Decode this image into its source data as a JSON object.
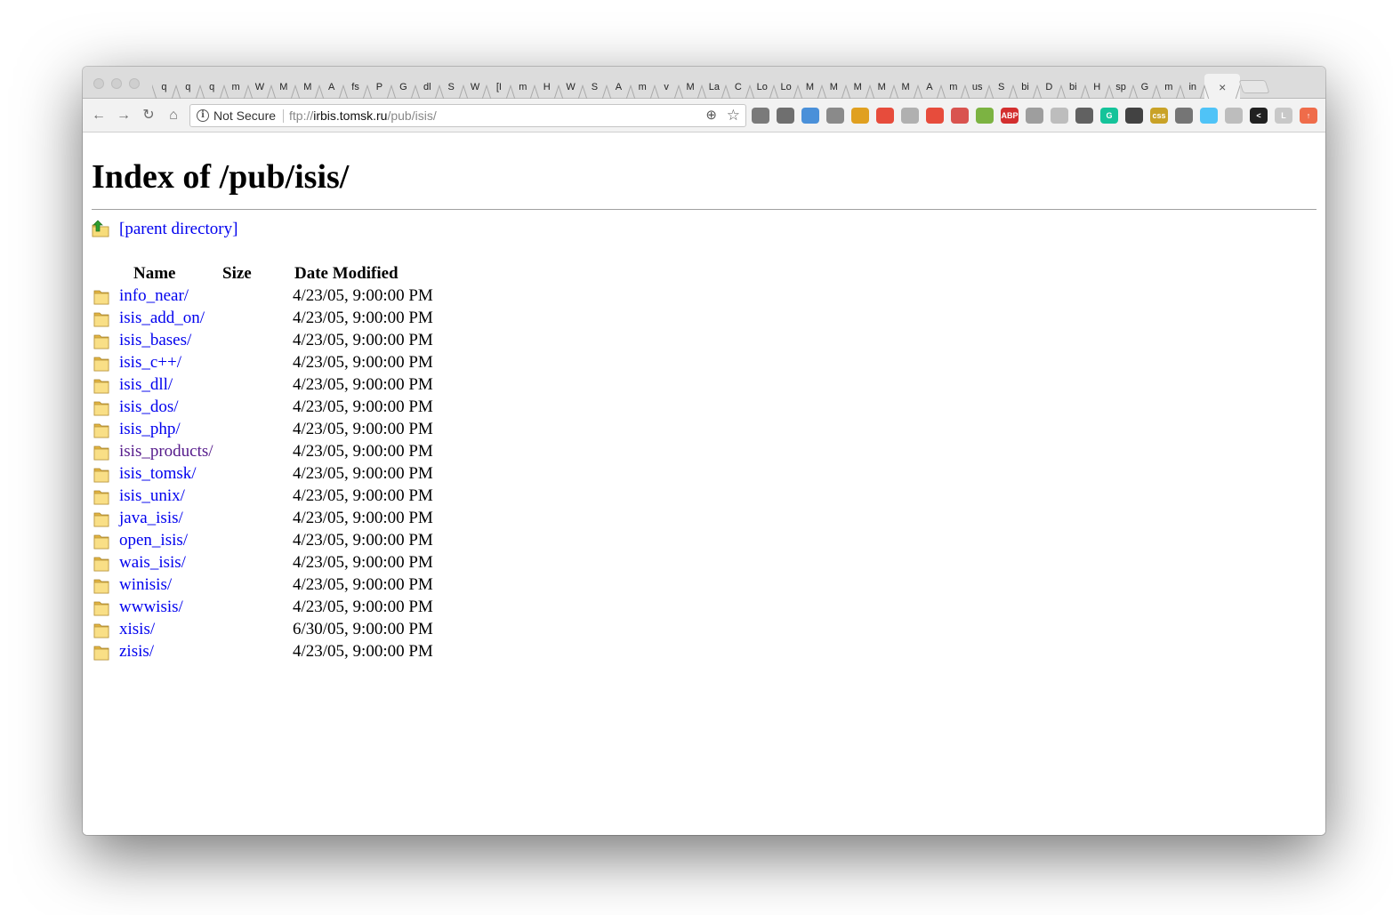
{
  "tabs": [
    "q",
    "q",
    "q",
    "m",
    "W",
    "M",
    "M",
    "A",
    "fs",
    "P",
    "G",
    "dl",
    "S",
    "W",
    "[I",
    "m",
    "H",
    "W",
    "S",
    "A",
    "m",
    "v",
    "M",
    "La",
    "C",
    "Lo",
    "Lo",
    "M",
    "M",
    "M",
    "M",
    "M",
    "A",
    "m",
    "us",
    "S",
    "bi",
    "D",
    "bi",
    "H",
    "sp",
    "G",
    "m",
    "in"
  ],
  "active_tab_close": "×",
  "toolbar": {
    "back_icon": "←",
    "forward_icon": "→",
    "reload_icon": "↻",
    "home_icon": "⌂",
    "security_label": "Not Secure",
    "url_scheme": "ftp://",
    "url_host": "irbis.tomsk.ru",
    "url_path": "/pub/isis/",
    "zoom_icon": "⊕",
    "star_icon": "☆"
  },
  "extensions": [
    {
      "name": "evernote-icon",
      "color": "#7a7a7a",
      "glyph": ""
    },
    {
      "name": "pocket-icon",
      "color": "#6f6f6f",
      "glyph": ""
    },
    {
      "name": "extension-blue-icon",
      "color": "#4a90d9",
      "glyph": ""
    },
    {
      "name": "extension-gray-icon",
      "color": "#8a8a8a",
      "glyph": ""
    },
    {
      "name": "extension-color-icon",
      "color": "#e0a020",
      "glyph": ""
    },
    {
      "name": "extension-red-icon",
      "color": "#e74c3c",
      "glyph": ""
    },
    {
      "name": "extension-circle-icon",
      "color": "#b0b0b0",
      "glyph": ""
    },
    {
      "name": "extension-shield-icon",
      "color": "#e74c3c",
      "glyph": ""
    },
    {
      "name": "extension-ad-icon",
      "color": "#d9534f",
      "glyph": ""
    },
    {
      "name": "extension-green-icon",
      "color": "#7cb342",
      "glyph": ""
    },
    {
      "name": "adblock-plus-icon",
      "color": "#d32f2f",
      "glyph": "ABP"
    },
    {
      "name": "extension-globe-icon",
      "color": "#9e9e9e",
      "glyph": ""
    },
    {
      "name": "extension-check-icon",
      "color": "#bdbdbd",
      "glyph": ""
    },
    {
      "name": "extension-ghost-icon",
      "color": "#616161",
      "glyph": ""
    },
    {
      "name": "grammarly-icon",
      "color": "#15c39a",
      "glyph": "G"
    },
    {
      "name": "extension-bird-icon",
      "color": "#424242",
      "glyph": ""
    },
    {
      "name": "css-icon",
      "color": "#c9a227",
      "glyph": "css"
    },
    {
      "name": "extension-frame-icon",
      "color": "#757575",
      "glyph": ""
    },
    {
      "name": "extension-spiral-icon",
      "color": "#4fc3f7",
      "glyph": ""
    },
    {
      "name": "extension-sync-icon",
      "color": "#bdbdbd",
      "glyph": ""
    },
    {
      "name": "extension-chevron-icon",
      "color": "#212121",
      "glyph": "<"
    },
    {
      "name": "extension-l-icon",
      "color": "#c8c8c8",
      "glyph": "L"
    },
    {
      "name": "extension-upload-icon",
      "color": "#ef6c4a",
      "glyph": "↑"
    }
  ],
  "page": {
    "title": "Index of /pub/isis/",
    "parent_link": "[parent directory]",
    "columns": {
      "name": "Name",
      "size": "Size",
      "date": "Date Modified"
    },
    "entries": [
      {
        "name": "info_near/",
        "size": "",
        "date": "4/23/05, 9:00:00 PM",
        "visited": false
      },
      {
        "name": "isis_add_on/",
        "size": "",
        "date": "4/23/05, 9:00:00 PM",
        "visited": false
      },
      {
        "name": "isis_bases/",
        "size": "",
        "date": "4/23/05, 9:00:00 PM",
        "visited": false
      },
      {
        "name": "isis_c++/",
        "size": "",
        "date": "4/23/05, 9:00:00 PM",
        "visited": false
      },
      {
        "name": "isis_dll/",
        "size": "",
        "date": "4/23/05, 9:00:00 PM",
        "visited": false
      },
      {
        "name": "isis_dos/",
        "size": "",
        "date": "4/23/05, 9:00:00 PM",
        "visited": false
      },
      {
        "name": "isis_php/",
        "size": "",
        "date": "4/23/05, 9:00:00 PM",
        "visited": false
      },
      {
        "name": "isis_products/",
        "size": "",
        "date": "4/23/05, 9:00:00 PM",
        "visited": true
      },
      {
        "name": "isis_tomsk/",
        "size": "",
        "date": "4/23/05, 9:00:00 PM",
        "visited": false
      },
      {
        "name": "isis_unix/",
        "size": "",
        "date": "4/23/05, 9:00:00 PM",
        "visited": false
      },
      {
        "name": "java_isis/",
        "size": "",
        "date": "4/23/05, 9:00:00 PM",
        "visited": false
      },
      {
        "name": "open_isis/",
        "size": "",
        "date": "4/23/05, 9:00:00 PM",
        "visited": false
      },
      {
        "name": "wais_isis/",
        "size": "",
        "date": "4/23/05, 9:00:00 PM",
        "visited": false
      },
      {
        "name": "winisis/",
        "size": "",
        "date": "4/23/05, 9:00:00 PM",
        "visited": false
      },
      {
        "name": "wwwisis/",
        "size": "",
        "date": "4/23/05, 9:00:00 PM",
        "visited": false
      },
      {
        "name": "xisis/",
        "size": "",
        "date": "6/30/05, 9:00:00 PM",
        "visited": false
      },
      {
        "name": "zisis/",
        "size": "",
        "date": "4/23/05, 9:00:00 PM",
        "visited": false
      }
    ]
  }
}
